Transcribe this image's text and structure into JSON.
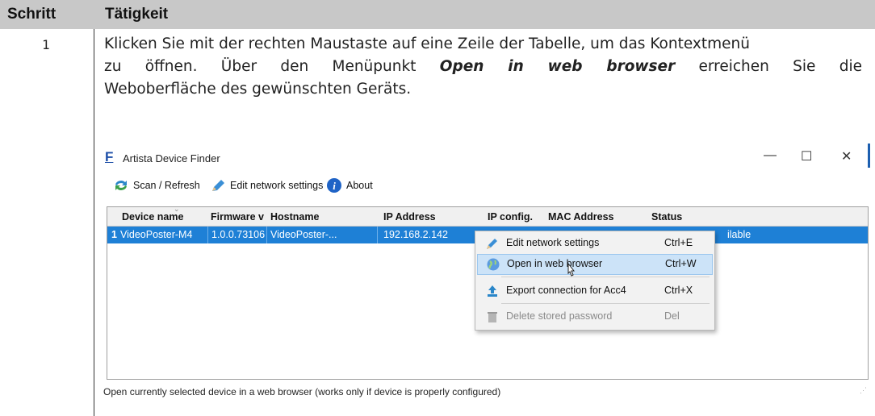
{
  "doc": {
    "col_step": "Schritt",
    "col_action": "Tätigkeit",
    "step_number": "1",
    "para_line1": "Klicken Sie mit der rechten Maustaste auf eine Zeile der Tabelle, um das Kontextmenü",
    "para_line2_a": "zu öffnen. Über den Menüpunkt",
    "para_line2_em": "Open in web browser",
    "para_line2_b": "erreichen Sie die",
    "para_line3": "Weboberfläche des gewünschten Geräts."
  },
  "window": {
    "title": "Artista Device Finder",
    "logo": "F",
    "controls": {
      "minimize": "—",
      "maximize": "☐",
      "close": "✕"
    },
    "toolbar": {
      "scan": "Scan / Refresh",
      "edit": "Edit network settings",
      "about": "About"
    },
    "columns": [
      "Device name",
      "Firmware v",
      "Hostname",
      "IP Address",
      "IP config.",
      "MAC Address",
      "Status"
    ],
    "row": {
      "index": "1",
      "device_name": "VideoPoster-M4",
      "firmware": "1.0.0.73106",
      "hostname": "VideoPoster-...",
      "ip": "192.168.2.142",
      "status_partial": "ilable"
    },
    "context_menu": [
      {
        "label": "Edit network settings",
        "shortcut": "Ctrl+E",
        "icon": "pencil-icon"
      },
      {
        "label": "Open in web browser",
        "shortcut": "Ctrl+W",
        "icon": "globe-icon",
        "highlighted": true
      },
      {
        "label": "Export connection for Acc4",
        "shortcut": "Ctrl+X",
        "icon": "export-icon"
      },
      {
        "label": "Delete stored password",
        "shortcut": "Del",
        "icon": "trash-icon",
        "disabled": true
      }
    ],
    "status_bar": "Open currently selected device in a web browser (works only if device is properly configured)"
  },
  "colors": {
    "selection": "#1e80d6",
    "menu_highlight": "#cce3f8",
    "header_bg": "#c8c8c8"
  }
}
